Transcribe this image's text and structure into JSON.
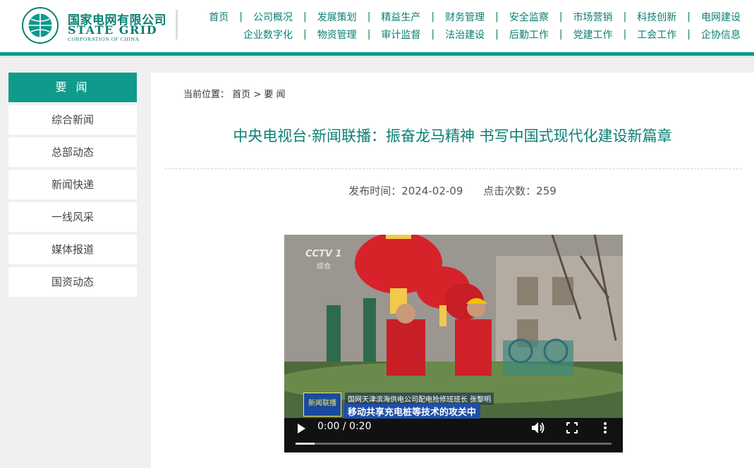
{
  "colors": {
    "brand": "#0f9a8c",
    "brand_text": "#0b7f73",
    "video_caption_bg": "#1f4fa8"
  },
  "logo": {
    "cn_name": "国家电网有限公司",
    "en_name": "STATE GRID",
    "en_sub": "CORPORATION OF CHINA",
    "icon": "state-grid-emblem"
  },
  "nav": {
    "row1": [
      "首页",
      "公司概况",
      "发展策划",
      "精益生产",
      "财务管理",
      "安全监察",
      "市场营销",
      "科技创新",
      "电网建设"
    ],
    "row2": [
      "企业数字化",
      "物资管理",
      "审计监督",
      "法治建设",
      "后勤工作",
      "党建工作",
      "工会工作",
      "企协信息"
    ],
    "separator": "|"
  },
  "sidebar": {
    "heading": "要 闻",
    "items": [
      "综合新闻",
      "总部动态",
      "新闻快递",
      "一线风采",
      "媒体报道",
      "国资动态"
    ]
  },
  "breadcrumb": {
    "prefix": "当前位置：",
    "home": "首页",
    "sep": ">",
    "current": "要 闻"
  },
  "article": {
    "title": "中央电视台·新闻联播：振奋龙马精神 书写中国式现代化建设新篇章",
    "publish": "发布时间：2024-02-09",
    "clicks": "点击次数：259"
  },
  "video": {
    "time": "0:00 / 0:20",
    "progress": 0.06,
    "watermark": "CCTV 1",
    "watermark_sub": "综合",
    "caption_logo": "新闻联播",
    "caption_line1": "国网天津滨海供电公司配电抢修班班长 张黎明",
    "caption_line2": "移动共享充电桩等技术的攻关中",
    "icons": [
      "play-icon",
      "volume-icon",
      "fullscreen-icon",
      "more-vertical-icon"
    ]
  }
}
